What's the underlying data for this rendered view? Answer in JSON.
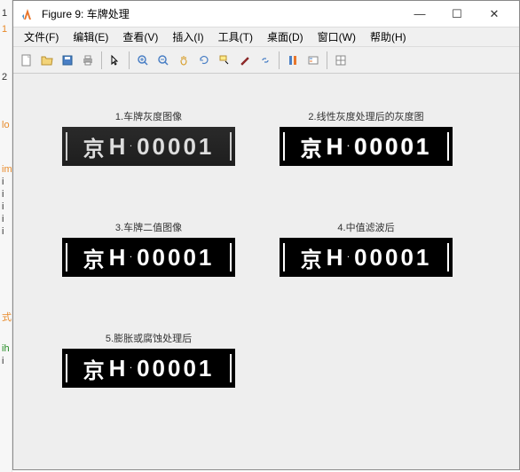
{
  "gutter": [
    "1",
    "",
    "2",
    "",
    "lo",
    "",
    "",
    "im",
    "i",
    "i",
    "i",
    "i",
    "i",
    "",
    "",
    "",
    "式)",
    "",
    "ih",
    "i"
  ],
  "window": {
    "title": "Figure 9: 车牌处理",
    "controls": {
      "min": "—",
      "max": "☐",
      "close": "✕"
    }
  },
  "menu": {
    "file": "文件(F)",
    "edit": "编辑(E)",
    "view": "查看(V)",
    "insert": "插入(I)",
    "tools": "工具(T)",
    "desktop": "桌面(D)",
    "window": "窗口(W)",
    "help": "帮助(H)"
  },
  "subplots": {
    "s1": {
      "title": "1.车牌灰度图像",
      "plate": {
        "cn": "京",
        "letters": "H",
        "dot": "·",
        "num": "00001"
      }
    },
    "s2": {
      "title": "2.线性灰度处理后的灰度图",
      "plate": {
        "cn": "京",
        "letters": "H",
        "dot": "·",
        "num": "00001"
      }
    },
    "s3": {
      "title": "3.车牌二值图像",
      "plate": {
        "cn": "京",
        "letters": "H",
        "dot": "·",
        "num": "00001"
      }
    },
    "s4": {
      "title": "4.中值滤波后",
      "plate": {
        "cn": "京",
        "letters": "H",
        "dot": "·",
        "num": "00001"
      }
    },
    "s5": {
      "title": "5.膨胀或腐蚀处理后",
      "plate": {
        "cn": "京",
        "letters": "H",
        "dot": "·",
        "num": "00001"
      }
    }
  }
}
